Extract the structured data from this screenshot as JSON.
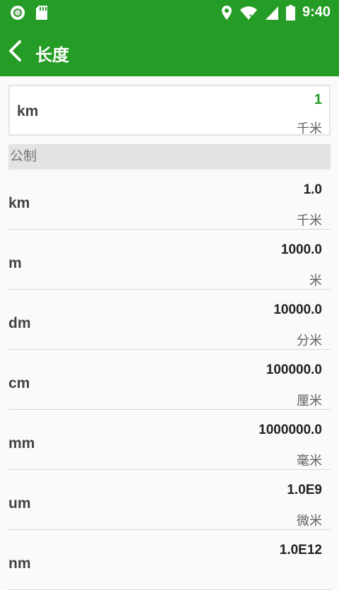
{
  "status_bar": {
    "time": "9:40",
    "icons_left": [
      "circle-notification-icon",
      "sd-card-icon"
    ],
    "icons_right": [
      "location-icon",
      "wifi-icon",
      "signal-icon",
      "battery-icon"
    ]
  },
  "app_bar": {
    "title": "长度",
    "back_icon": "chevron-left-icon",
    "color": "#249c25"
  },
  "input": {
    "unit": "km",
    "value": "1",
    "name": "千米",
    "value_color": "#249c25"
  },
  "section": {
    "label": "公制"
  },
  "rows": [
    {
      "unit": "km",
      "value": "1.0",
      "name": "千米"
    },
    {
      "unit": "m",
      "value": "1000.0",
      "name": "米"
    },
    {
      "unit": "dm",
      "value": "10000.0",
      "name": "分米"
    },
    {
      "unit": "cm",
      "value": "100000.0",
      "name": "厘米"
    },
    {
      "unit": "mm",
      "value": "1000000.0",
      "name": "毫米"
    },
    {
      "unit": "um",
      "value": "1.0E9",
      "name": "微米"
    },
    {
      "unit": "nm",
      "value": "1.0E12",
      "name": ""
    }
  ]
}
